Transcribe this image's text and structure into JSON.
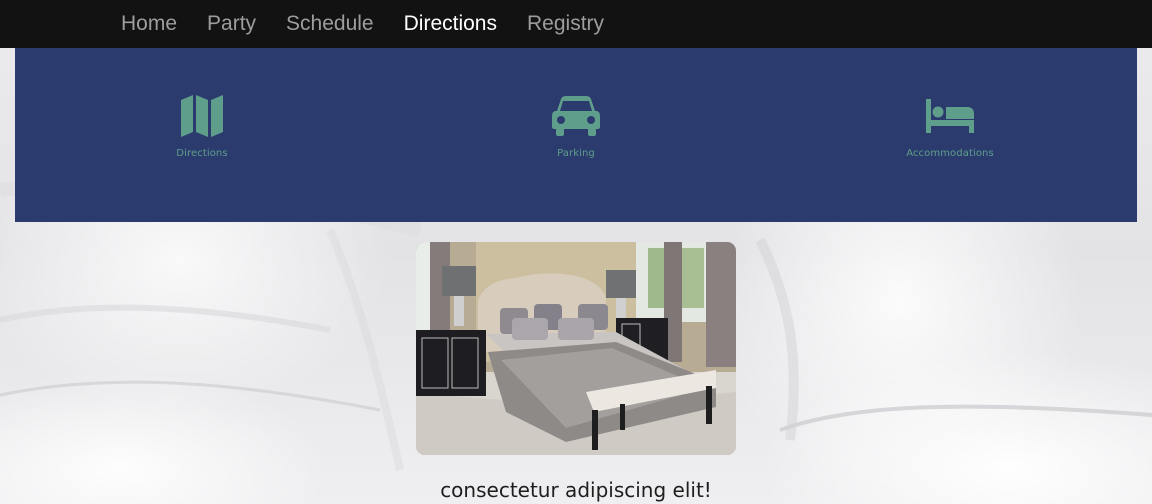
{
  "nav": {
    "items": [
      {
        "label": "Home",
        "active": false
      },
      {
        "label": "Party",
        "active": false
      },
      {
        "label": "Schedule",
        "active": false
      },
      {
        "label": "Directions",
        "active": true
      },
      {
        "label": "Registry",
        "active": false
      }
    ]
  },
  "banner": {
    "background": "#2c3b6e",
    "accent": "#5e9e8a",
    "features": [
      {
        "icon": "map-icon",
        "label": "Directions"
      },
      {
        "icon": "car-icon",
        "label": "Parking"
      },
      {
        "icon": "bed-icon",
        "label": "Accommodations"
      }
    ]
  },
  "content": {
    "photo": "bedroom-photo",
    "caption": "consectetur adipiscing elit!"
  }
}
